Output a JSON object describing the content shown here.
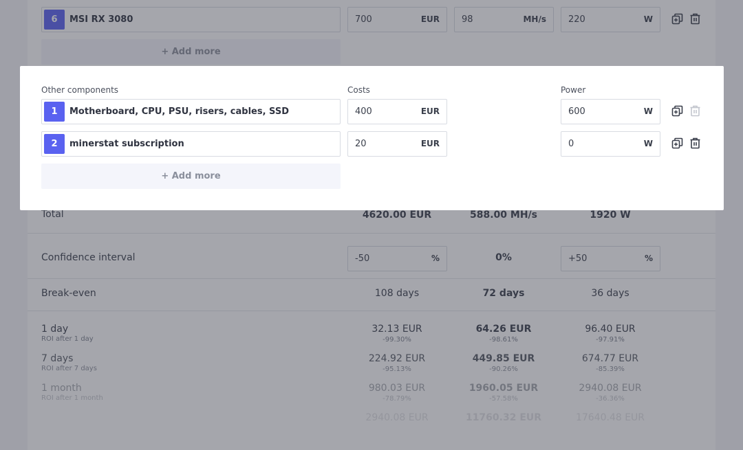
{
  "background": {
    "gpu_row": {
      "number": "6",
      "name": "MSI RX 3080",
      "cost": "700",
      "cost_unit": "EUR",
      "hashrate": "98",
      "hashrate_unit": "MH/s",
      "power": "220",
      "power_unit": "W"
    },
    "add_more_label": "+ Add more",
    "total": {
      "label": "Total",
      "cost": "4620.00 EUR",
      "hashrate": "588.00 MH/s",
      "power": "1920 W"
    },
    "confidence": {
      "label": "Confidence interval",
      "low": "-50",
      "low_unit": "%",
      "mid": "0%",
      "high": "+50",
      "high_unit": "%"
    },
    "breakeven": {
      "label": "Break-even",
      "low": "108 days",
      "mid": "72 days",
      "high": "36 days"
    },
    "periods": [
      {
        "label": "1 day",
        "sub": "ROI after 1 day",
        "low": "32.13 EUR",
        "low_sub": "-99.30%",
        "mid": "64.26 EUR",
        "mid_sub": "-98.61%",
        "high": "96.40 EUR",
        "high_sub": "-97.91%"
      },
      {
        "label": "7 days",
        "sub": "ROI after 7 days",
        "low": "224.92 EUR",
        "low_sub": "-95.13%",
        "mid": "449.85 EUR",
        "mid_sub": "-90.26%",
        "high": "674.77 EUR",
        "high_sub": "-85.39%"
      },
      {
        "label": "1 month",
        "sub": "ROI after 1 month",
        "low": "980.03 EUR",
        "low_sub": "-78.79%",
        "mid": "1960.05 EUR",
        "mid_sub": "-57.58%",
        "high": "2940.08 EUR",
        "high_sub": "-36.36%"
      },
      {
        "label": "",
        "sub": "",
        "low": "2940.08 EUR",
        "low_sub": "",
        "mid": "11760.32 EUR",
        "mid_sub": "",
        "high": "17640.48 EUR",
        "high_sub": ""
      }
    ]
  },
  "modal": {
    "headers": {
      "components": "Other components",
      "costs": "Costs",
      "power": "Power"
    },
    "rows": [
      {
        "number": "1",
        "name": "Motherboard, CPU, PSU, risers, cables, SSD",
        "cost": "400",
        "cost_unit": "EUR",
        "power": "600",
        "power_unit": "W"
      },
      {
        "number": "2",
        "name": "minerstat subscription",
        "cost": "20",
        "cost_unit": "EUR",
        "power": "0",
        "power_unit": "W"
      }
    ],
    "add_more_label": "+ Add more"
  },
  "colors": {
    "accent": "#5a62f0",
    "overlay": "rgba(55,58,70,0.45)"
  }
}
